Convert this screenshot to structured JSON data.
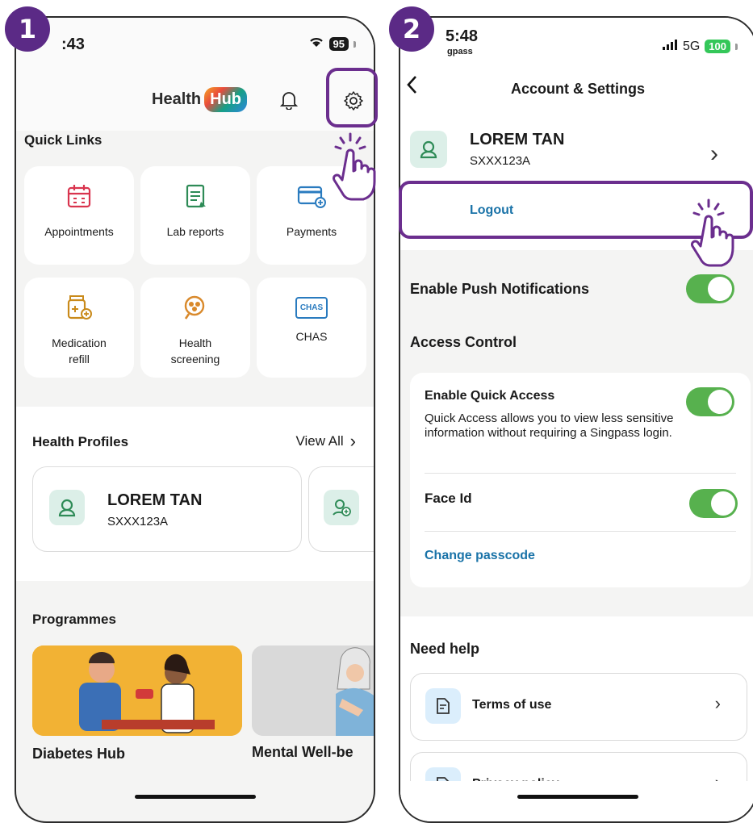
{
  "steps": {
    "one": "1",
    "two": "2"
  },
  "phone1": {
    "status": {
      "time": ":43",
      "battery": "95"
    },
    "logo": {
      "health": "Health",
      "hub": "Hub"
    },
    "quick_links": {
      "title": "Quick Links",
      "items": [
        {
          "label": "Appointments",
          "icon": "calendar-icon"
        },
        {
          "label": "Lab reports",
          "icon": "clipboard-icon"
        },
        {
          "label": "Payments",
          "icon": "card-icon"
        },
        {
          "label": "Medication\nrefill",
          "icon": "medicine-bottle-icon"
        },
        {
          "label": "Health\nscreening",
          "icon": "magnifier-icon"
        },
        {
          "label": "CHAS",
          "icon": "chas-icon"
        }
      ],
      "chas_badge": "CHAS"
    },
    "health_profiles": {
      "title": "Health Profiles",
      "view_all": "View All",
      "name": "LOREM TAN",
      "id": "SXXX123A"
    },
    "programmes": {
      "title": "Programmes",
      "items": [
        {
          "label": "Diabetes Hub"
        },
        {
          "label": "Mental Well-be"
        }
      ]
    }
  },
  "phone2": {
    "status": {
      "time": "5:48",
      "carrier": "gpass",
      "network": "5G",
      "battery": "100"
    },
    "title": "Account & Settings",
    "profile": {
      "name": "LOREM TAN",
      "id": "SXXX123A"
    },
    "logout": "Logout",
    "push": {
      "label": "Enable Push Notifications",
      "on": true
    },
    "access": {
      "title": "Access Control",
      "quick_access": "Enable Quick Access",
      "quick_desc": "Quick Access allows you to view less sensitive information without requiring a Singpass login.",
      "face_id": "Face Id",
      "change_passcode": "Change passcode"
    },
    "help": {
      "title": "Need help",
      "terms": "Terms of use",
      "privacy": "Privacy policy"
    }
  },
  "colors": {
    "accent": "#6b2e8e",
    "badge": "#5b2a86",
    "toggle": "#57b14e",
    "link": "#1a73a8"
  }
}
